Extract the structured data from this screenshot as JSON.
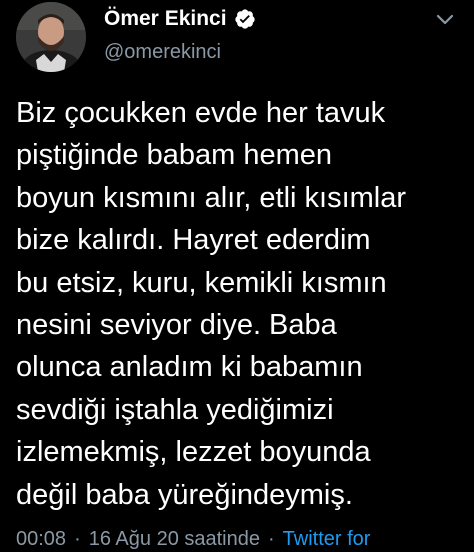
{
  "author": {
    "display_name": "Ömer Ekinci",
    "handle": "@omerekinci",
    "verified": true
  },
  "tweet": {
    "text": "Biz çocukken evde her tavuk\npiştiğinde babam hemen\nboyun kısmını alır, etli kısımlar\nbize kalırdı. Hayret ederdim\nbu etsiz, kuru, kemikli kısmın\nnesini seviyor diye. Baba\nolunca anladım ki babamın\nsevdiği iştahla yediğimizi\nizlemekmiş, lezzet boyunda\ndeğil baba yüreğindeymiş."
  },
  "meta": {
    "time": "00:08",
    "date": "16 Ağu 20 saatinde",
    "separator": "·",
    "source": "Twitter for"
  },
  "icons": {
    "verified": "verified-badge-icon",
    "more": "chevron-down-icon"
  },
  "colors": {
    "background": "#000000",
    "text": "#ffffff",
    "secondary": "#8b98a5",
    "link": "#1d9bf0"
  }
}
